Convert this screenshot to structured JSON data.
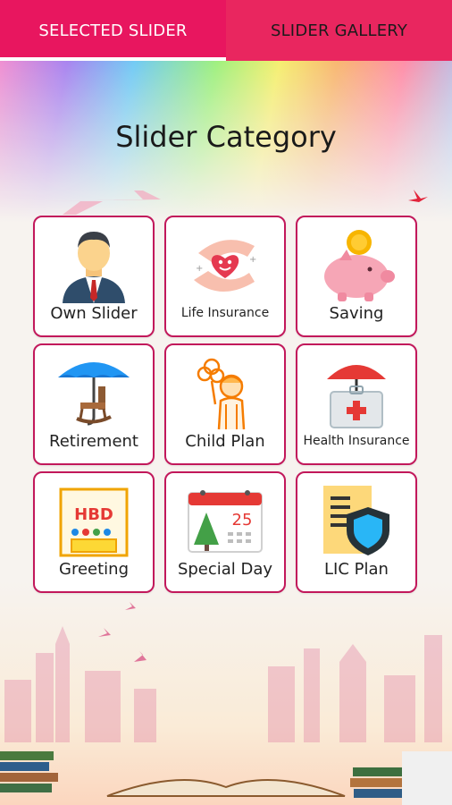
{
  "tabs": [
    {
      "label": "SELECTED SLIDER",
      "active": true
    },
    {
      "label": "SLIDER GALLERY",
      "active": false
    }
  ],
  "page_title": "Slider Category",
  "categories": [
    {
      "label": "Own Slider",
      "icon": "businessman-icon"
    },
    {
      "label": "Life Insurance",
      "icon": "hands-heart-icon"
    },
    {
      "label": "Saving",
      "icon": "piggy-bank-icon"
    },
    {
      "label": "Retirement",
      "icon": "umbrella-rocking-chair-icon"
    },
    {
      "label": "Child Plan",
      "icon": "child-balloon-icon"
    },
    {
      "label": "Health Insurance",
      "icon": "umbrella-medical-kit-icon"
    },
    {
      "label": "Greeting",
      "icon": "hbd-card-icon"
    },
    {
      "label": "Special Day",
      "icon": "calendar-tree-icon"
    },
    {
      "label": "LIC Plan",
      "icon": "document-shield-icon"
    }
  ],
  "icon_texts": {
    "greeting": "HBD",
    "special_day_date": "25"
  },
  "colors": {
    "tab_bar": "#e8165f",
    "card_border": "#c2185b"
  }
}
